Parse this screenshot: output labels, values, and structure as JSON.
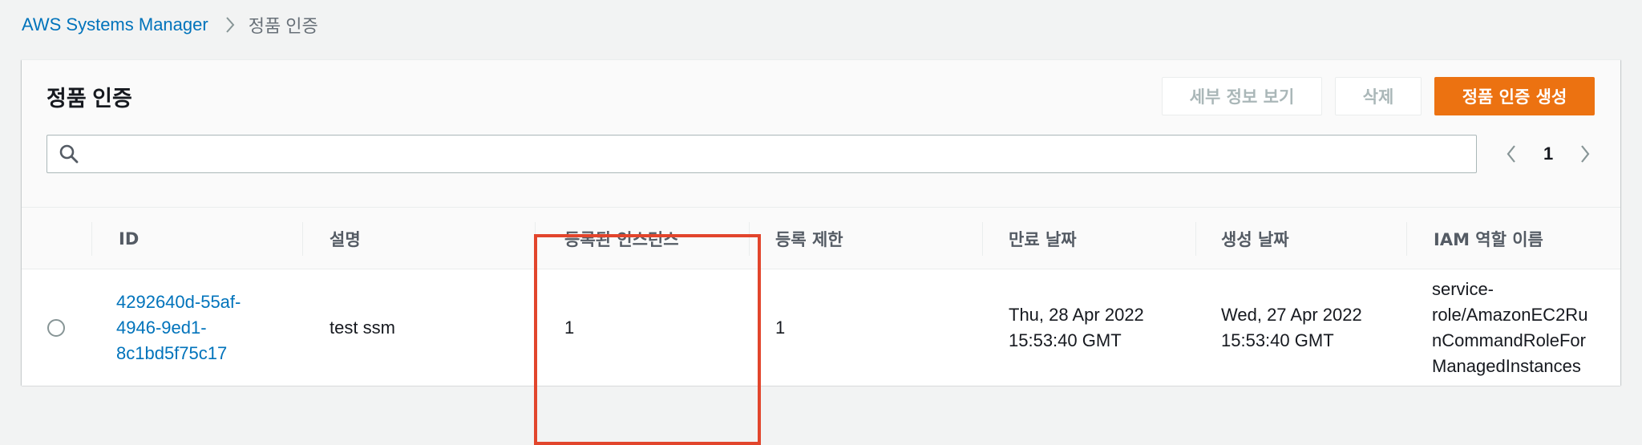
{
  "breadcrumb": {
    "root": "AWS Systems Manager",
    "current": "정품 인증"
  },
  "panel": {
    "title": "정품 인증",
    "buttons": {
      "details": "세부 정보 보기",
      "delete": "삭제",
      "create": "정품 인증 생성"
    },
    "search": {
      "placeholder": "",
      "value": ""
    },
    "pagination": {
      "current_page": "1"
    }
  },
  "table": {
    "columns": [
      "ID",
      "설명",
      "등록된 인스턴스",
      "등록 제한",
      "만료 날짜",
      "생성 날짜",
      "IAM 역할 이름"
    ],
    "rows": [
      {
        "id_lines": [
          "4292640d-55af-",
          "4946-9ed1-",
          "8c1bd5f75c17"
        ],
        "description": "test ssm",
        "registered_instances": "1",
        "registration_limit": "1",
        "expiration_lines": [
          "Thu, 28 Apr 2022",
          "15:53:40 GMT"
        ],
        "created_lines": [
          "Wed, 27 Apr 2022",
          "15:53:40 GMT"
        ],
        "iam_role_lines": [
          "service-",
          "role/AmazonEC2Ru",
          "nCommandRoleFor",
          "ManagedInstances"
        ]
      }
    ]
  },
  "colors": {
    "primary_button": "#ec7211",
    "link": "#0073bb",
    "highlight_border": "#e2452c"
  },
  "icons": {
    "breadcrumb_separator": "chevron-right-icon",
    "search": "search-icon",
    "pager_prev": "chevron-left-icon",
    "pager_next": "chevron-right-icon"
  }
}
